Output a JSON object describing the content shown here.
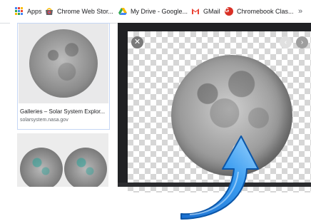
{
  "bookmarks": [
    {
      "label": "Apps",
      "icon": "apps-grid-icon"
    },
    {
      "label": "Chrome Web Stor...",
      "icon": "chrome-web-store-icon"
    },
    {
      "label": "My Drive - Google...",
      "icon": "google-drive-icon"
    },
    {
      "label": "GMail",
      "icon": "gmail-icon"
    },
    {
      "label": "Chromebook Clas...",
      "icon": "chromebook-icon"
    }
  ],
  "overflow_label": "»",
  "results": [
    {
      "title": "Galleries – Solar System Explor...",
      "source": "solarsystem.nasa.gov"
    }
  ],
  "viewer": {
    "close_symbol": "✕",
    "prev_symbol": "‹",
    "next_symbol": "›"
  },
  "colors": {
    "viewer_bg": "#202124",
    "selected_border": "#c5d6f5",
    "arrow_blue": "#2f8fe6"
  }
}
